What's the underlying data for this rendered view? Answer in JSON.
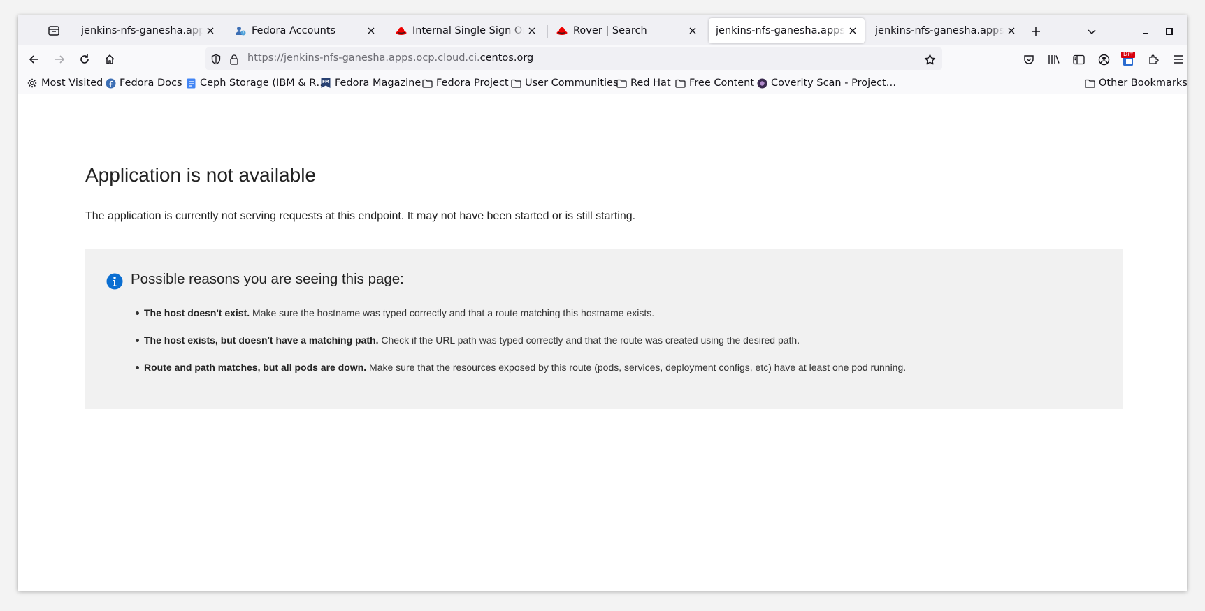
{
  "browser": {
    "tabs": [
      {
        "title": "jenkins-nfs-ganesha.apps.ocp.cloud.ci.centos.org",
        "favicon": "none",
        "selected": false
      },
      {
        "title": "Fedora Accounts",
        "favicon": "fedora-accounts-icon",
        "selected": false
      },
      {
        "title": "Internal Single Sign On",
        "favicon": "redhat-icon",
        "selected": false
      },
      {
        "title": "Rover | Search",
        "favicon": "redhat-icon",
        "selected": false
      },
      {
        "title": "jenkins-nfs-ganesha.apps.ocp.cloud.ci.centos.org",
        "favicon": "none",
        "selected": true
      },
      {
        "title": "jenkins-nfs-ganesha.apps.ocp.cloud.ci.centos.org",
        "favicon": "none",
        "selected": false
      }
    ],
    "url": {
      "prefix": "https://jenkins-nfs-ganesha.apps.ocp.cloud.ci.",
      "domain": "centos.org"
    },
    "bookmarks": [
      {
        "label": "Most Visited",
        "icon": "gear-icon"
      },
      {
        "label": "Fedora Docs",
        "icon": "fedora-icon"
      },
      {
        "label": "Ceph Storage (IBM & R…",
        "icon": "doc-icon"
      },
      {
        "label": "Fedora Magazine",
        "icon": "fm-icon"
      },
      {
        "label": "Fedora Project",
        "icon": "folder-icon"
      },
      {
        "label": "User Communities",
        "icon": "folder-icon"
      },
      {
        "label": "Red Hat",
        "icon": "folder-icon"
      },
      {
        "label": "Free Content",
        "icon": "folder-icon"
      },
      {
        "label": "Coverity Scan - Project…",
        "icon": "coverity-icon"
      }
    ],
    "other_bookmarks": "Other Bookmarks",
    "diff_badge": "Diff",
    "colors": {
      "accent": "#0a6ed1",
      "redhat": "#ee0000",
      "fedora": "#3c6eb4"
    }
  },
  "page": {
    "title": "Application is not available",
    "description": "The application is currently not serving requests at this endpoint. It may not have been started or is still starting.",
    "reasons_title": "Possible reasons you are seeing this page:",
    "reasons": [
      {
        "bold": "The host doesn't exist.",
        "text": " Make sure the hostname was typed correctly and that a route matching this hostname exists."
      },
      {
        "bold": "The host exists, but doesn't have a matching path.",
        "text": " Check if the URL path was typed correctly and that the route was created using the desired path."
      },
      {
        "bold": "Route and path matches, but all pods are down.",
        "text": " Make sure that the resources exposed by this route (pods, services, deployment configs, etc) have at least one pod running."
      }
    ]
  }
}
